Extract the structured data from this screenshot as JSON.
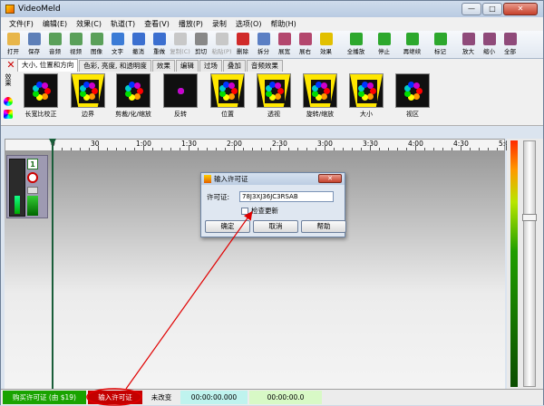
{
  "window": {
    "title": "VideoMeld",
    "min": "—",
    "max": "□",
    "close": "✕"
  },
  "menu": [
    "文件(F)",
    "编辑(E)",
    "效果(C)",
    "轨道(T)",
    "查看(V)",
    "播放(P)",
    "录制",
    "选项(O)",
    "帮助(H)"
  ],
  "toolbar": [
    {
      "label": "打开",
      "icon": "folder-open-icon",
      "color": "#e8b64a"
    },
    {
      "label": "保存",
      "icon": "save-icon",
      "color": "#5d7fb8"
    },
    {
      "label": "音频",
      "icon": "audio-icon",
      "color": "#5aa05a"
    },
    {
      "label": "视频",
      "icon": "video-icon",
      "color": "#5aa05a"
    },
    {
      "label": "图像",
      "icon": "image-icon",
      "color": "#5aa05a"
    },
    {
      "label": "文字",
      "icon": "text-icon",
      "color": "#3b7bd6"
    },
    {
      "label": "撤消",
      "icon": "undo-icon",
      "color": "#3b6fd0"
    },
    {
      "label": "重做",
      "icon": "redo-icon",
      "color": "#3b6fd0"
    },
    {
      "label": "复制(C)",
      "icon": "copy-icon",
      "color": "#c8c8c8",
      "dim": true
    },
    {
      "label": "剪切",
      "icon": "cut-icon",
      "color": "#888888"
    },
    {
      "label": "粘贴(P)",
      "icon": "paste-icon",
      "color": "#c8c8c8",
      "dim": true
    },
    {
      "label": "删除",
      "icon": "delete-icon",
      "color": "#d02a2a"
    },
    {
      "label": "拆分",
      "icon": "split-icon",
      "color": "#5b7fc4"
    },
    {
      "label": "展宽",
      "icon": "expand-icon",
      "color": "#b3476e"
    },
    {
      "label": "展右",
      "icon": "expand-right-icon",
      "color": "#b3476e"
    },
    {
      "label": "效果",
      "icon": "effects-icon",
      "color": "#e2c000"
    },
    {
      "label": "全播放",
      "icon": "play-all-icon",
      "color": "#2da82d",
      "wide": true
    },
    {
      "label": "停止",
      "icon": "stop-icon",
      "color": "#2da82d",
      "wide": true
    },
    {
      "label": "再继续",
      "icon": "resume-icon",
      "color": "#2da82d",
      "wide": true
    },
    {
      "label": "标记",
      "icon": "mark-icon",
      "color": "#2da82d",
      "wide": true
    },
    {
      "label": "放大",
      "icon": "zoom-in-icon",
      "color": "#8f4a7a"
    },
    {
      "label": "缩小",
      "icon": "zoom-out-icon",
      "color": "#8f4a7a"
    },
    {
      "label": "全部",
      "icon": "zoom-all-icon",
      "color": "#8f4a7a"
    }
  ],
  "tabs": [
    "大小, 位置和方向",
    "色彩, 亮度, 和透明度",
    "效果",
    "编辑",
    "过场",
    "叠加",
    "音频效果"
  ],
  "effects_side_label": "效果",
  "effects": [
    "长宽比校正",
    "边界",
    "剪裁/化/缩放",
    "反转",
    "位置",
    "透视",
    "旋转/缩放",
    "大小",
    "视区"
  ],
  "ruler": [
    "0",
    "30",
    "1:00",
    "1:30",
    "2:00",
    "2:30",
    "3:00",
    "3:30",
    "4:00",
    "4:30",
    "5:0"
  ],
  "clip": {
    "number": "1"
  },
  "dialog": {
    "title": "输入许可证",
    "close": "✕",
    "license_label": "许可证:",
    "license_value": "78J3XJ36JC3RSAB",
    "checkbox_label": "检查更新",
    "ok": "确定",
    "cancel": "取消",
    "help": "帮助"
  },
  "status": {
    "buy": "购买许可证 (由 $19)",
    "enter": "输入许可证",
    "state": "未改变",
    "time1": "00:00:00.000",
    "time2": "00:00:00.0"
  },
  "colors": {
    "buy": "#19a300",
    "enter": "#c40000",
    "annotation": "#e00000"
  }
}
